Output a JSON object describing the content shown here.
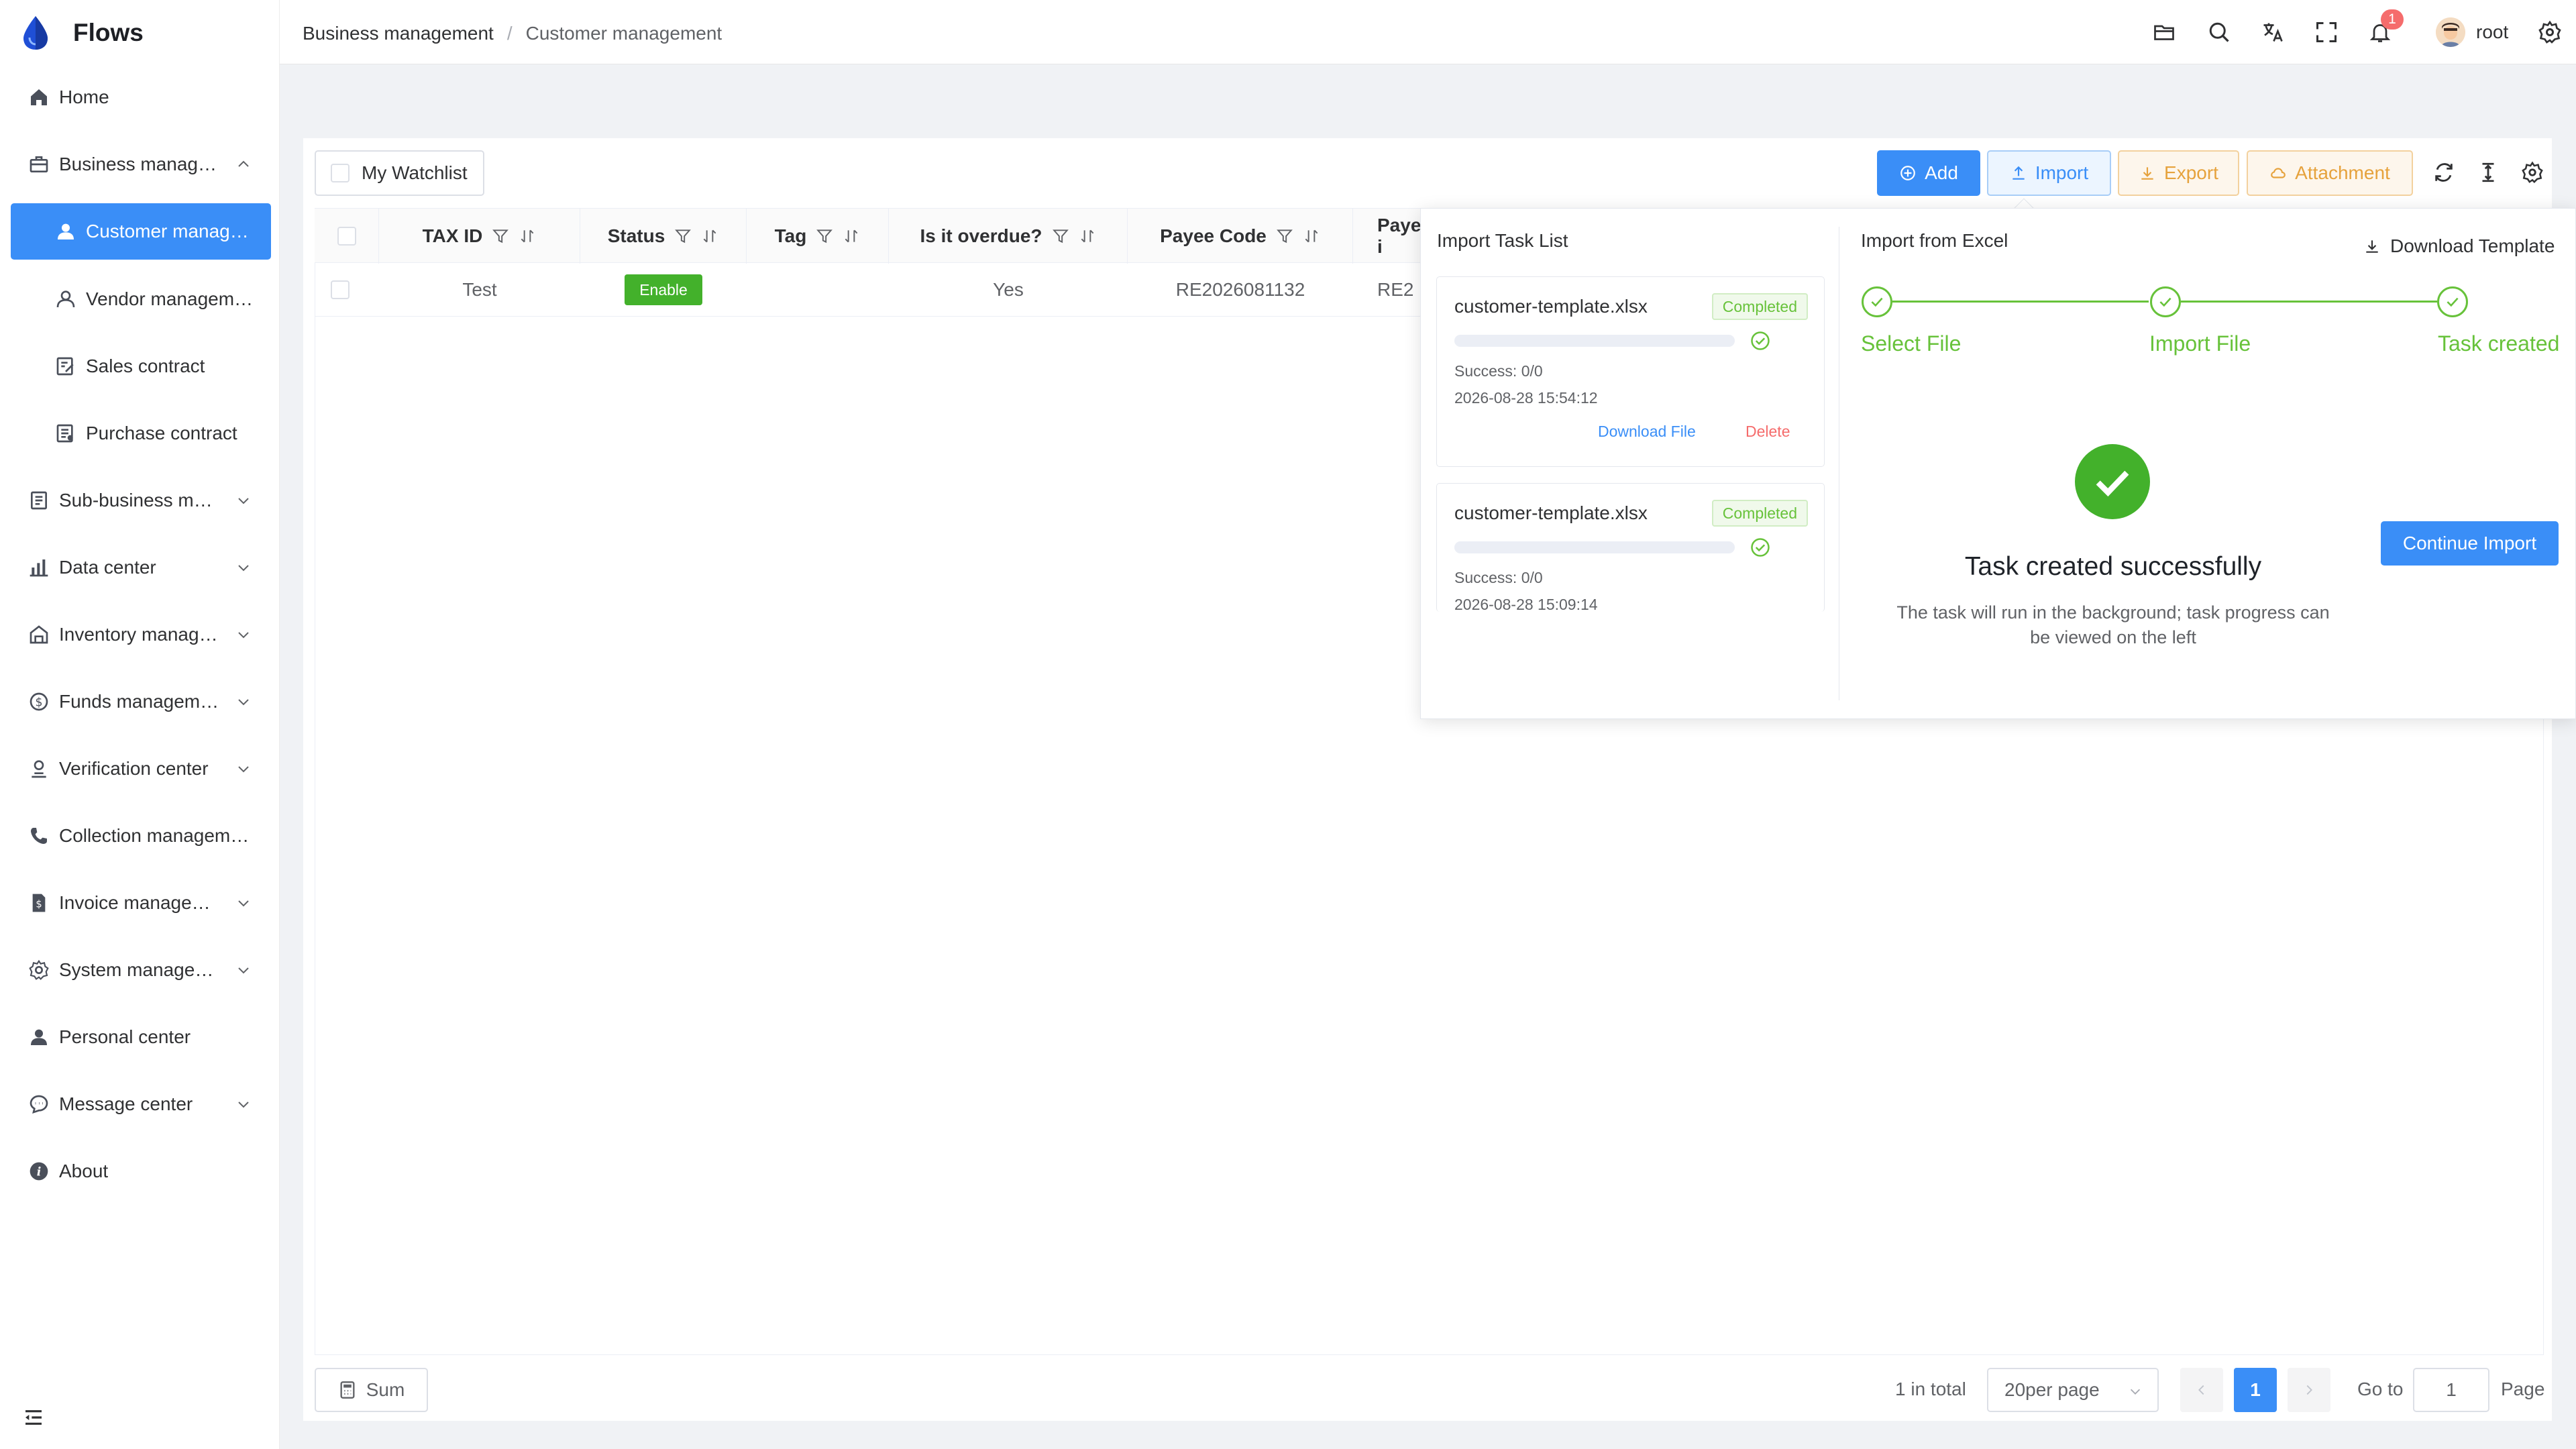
{
  "app": {
    "name": "Flows"
  },
  "sidebar": {
    "items": [
      {
        "label": "Home",
        "icon": "home-icon"
      },
      {
        "label": "Business manag…",
        "icon": "briefcase-icon"
      },
      {
        "label": "Customer manag…",
        "icon": "user-icon"
      },
      {
        "label": "Vendor managem…",
        "icon": "user-outline-icon"
      },
      {
        "label": "Sales contract",
        "icon": "contract-edit-icon"
      },
      {
        "label": "Purchase contract",
        "icon": "contract-icon"
      },
      {
        "label": "Sub-business m…",
        "icon": "document-icon"
      },
      {
        "label": "Data center",
        "icon": "bar-chart-icon"
      },
      {
        "label": "Inventory manag…",
        "icon": "warehouse-icon"
      },
      {
        "label": "Funds managem…",
        "icon": "money-icon"
      },
      {
        "label": "Verification center",
        "icon": "verify-user-icon"
      },
      {
        "label": "Collection managem…",
        "icon": "phone-icon"
      },
      {
        "label": "Invoice manage…",
        "icon": "invoice-icon"
      },
      {
        "label": "System manage…",
        "icon": "gear-icon"
      },
      {
        "label": "Personal center",
        "icon": "person-icon"
      },
      {
        "label": "Message center",
        "icon": "chat-icon"
      },
      {
        "label": "About",
        "icon": "info-icon"
      }
    ]
  },
  "header": {
    "breadcrumb": [
      "Business management",
      "Customer management"
    ],
    "breadcrumb_separator": "/",
    "notification_count": "1",
    "user": "root"
  },
  "toolbar": {
    "watchlist_label": "My Watchlist",
    "add_label": "Add",
    "import_label": "Import",
    "export_label": "Export",
    "attachment_label": "Attachment"
  },
  "table": {
    "columns": [
      "TAX ID",
      "Status",
      "Tag",
      "Is it overdue?",
      "Payee Code",
      "Payee i"
    ],
    "rows": [
      {
        "tax_id": "Test",
        "status": "Enable",
        "tag": "",
        "overdue": "Yes",
        "payee_code": "RE2026081132",
        "payee": "RE2"
      }
    ]
  },
  "import_panel": {
    "task_list_title": "Import Task List",
    "excel_title": "Import from Excel",
    "download_template": "Download Template",
    "tasks": [
      {
        "file": "customer-template.xlsx",
        "status": "Completed",
        "success": "Success: 0/0",
        "time": "2026-08-28 15:54:12",
        "download": "Download File",
        "delete": "Delete"
      },
      {
        "file": "customer-template.xlsx",
        "status": "Completed",
        "success": "Success: 0/0",
        "time": "2026-08-28 15:09:14"
      }
    ],
    "steps": [
      "Select File",
      "Import File",
      "Task created"
    ],
    "success_title": "Task created successfully",
    "success_desc": "The task will run in the background; task progress can be viewed on the left",
    "continue_label": "Continue Import"
  },
  "footer": {
    "sum_label": "Sum",
    "total": "1 in total",
    "page_size": "20per page",
    "current_page": "1",
    "goto_label": "Go to",
    "goto_value": "1",
    "page_label": "Page"
  },
  "colors": {
    "primary": "#3a8ef7",
    "success": "#43b12b",
    "warning": "#e6a23c",
    "danger": "#f56c6c"
  }
}
